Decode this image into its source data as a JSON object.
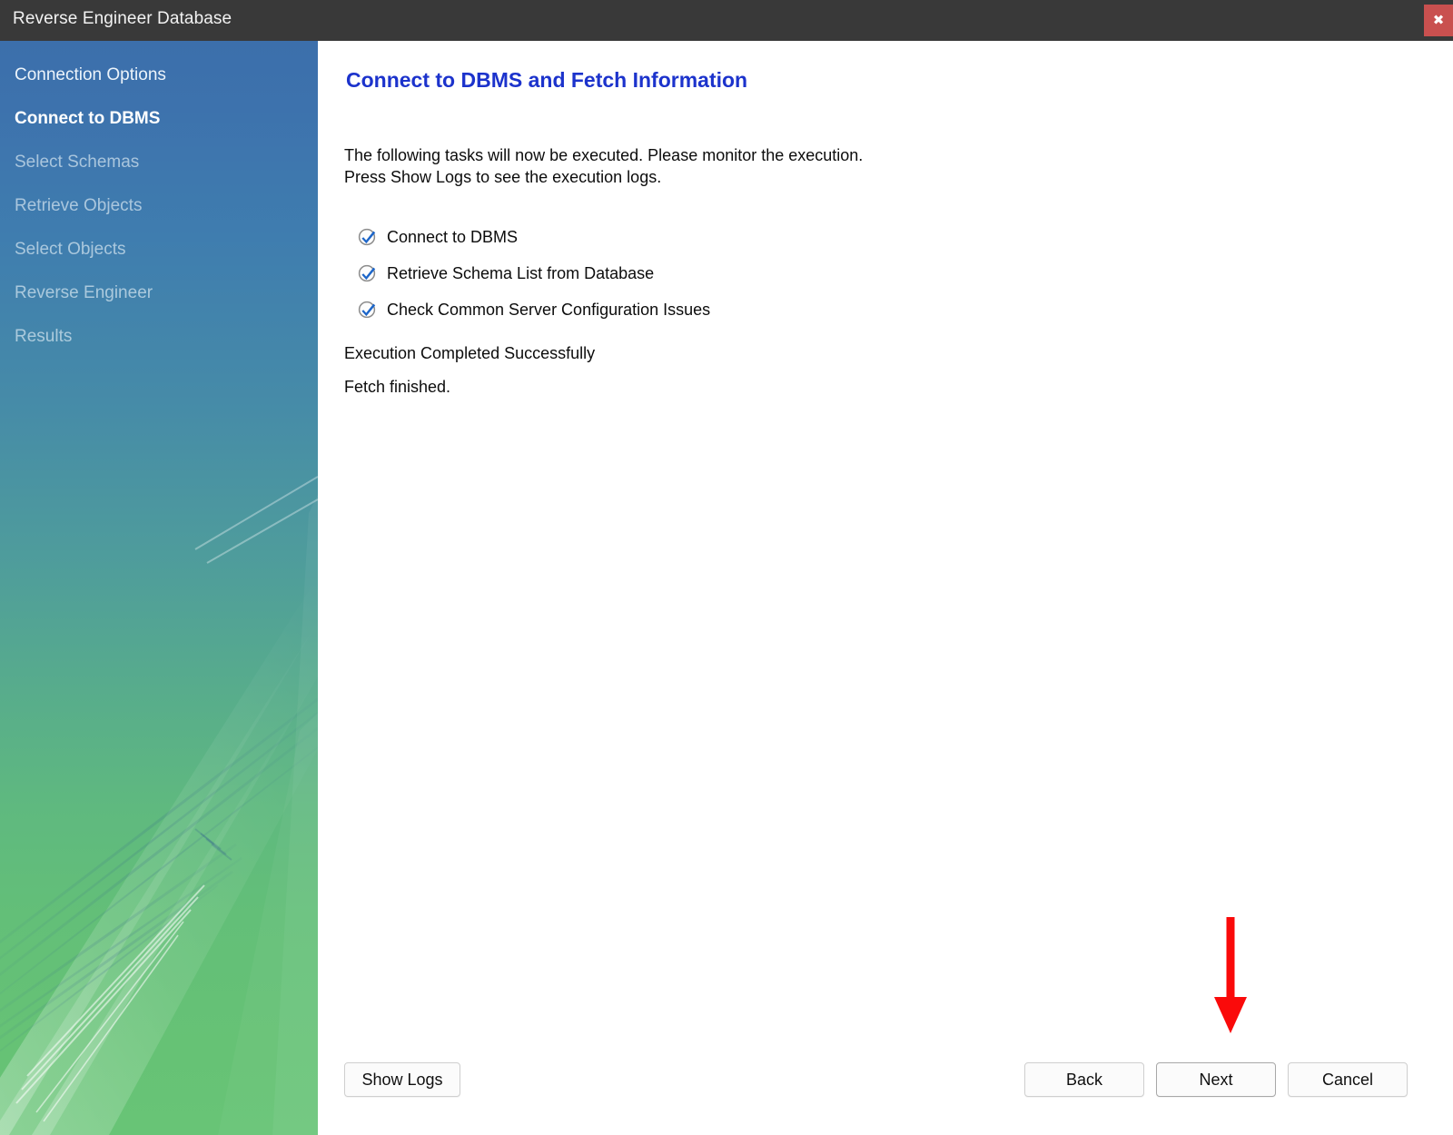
{
  "window": {
    "title": "Reverse Engineer Database",
    "close_label": "✖",
    "close_icon": "close-icon"
  },
  "sidebar": {
    "items": [
      {
        "label": "Connection Options",
        "state": "visited"
      },
      {
        "label": "Connect to DBMS",
        "state": "current"
      },
      {
        "label": "Select Schemas",
        "state": "upcoming"
      },
      {
        "label": "Retrieve Objects",
        "state": "upcoming"
      },
      {
        "label": "Select Objects",
        "state": "upcoming"
      },
      {
        "label": "Reverse Engineer",
        "state": "upcoming"
      },
      {
        "label": "Results",
        "state": "upcoming"
      }
    ]
  },
  "main": {
    "page_title": "Connect to DBMS and Fetch Information",
    "intro_line1": "The following tasks will now be executed. Please monitor the execution.",
    "intro_line2": "Press Show Logs to see the execution logs.",
    "tasks": [
      {
        "label": "Connect to DBMS",
        "checked": true,
        "icon": "check-circle-icon"
      },
      {
        "label": "Retrieve Schema List from Database",
        "checked": true,
        "icon": "check-circle-icon"
      },
      {
        "label": "Check Common Server Configuration Issues",
        "checked": true,
        "icon": "check-circle-icon"
      }
    ],
    "status_line1": "Execution Completed Successfully",
    "status_line2": "Fetch finished."
  },
  "annotation": {
    "icon": "down-arrow-icon",
    "color": "#fa0a0a",
    "points_to": "Next"
  },
  "footer": {
    "show_logs_label": "Show Logs",
    "back_label": "Back",
    "next_label": "Next",
    "cancel_label": "Cancel"
  },
  "colors": {
    "titlebar_bg": "#393939",
    "close_bg": "#c9504f",
    "sidebar_top": "#3c6fab",
    "sidebar_bottom": "#68c476",
    "heading": "#1c33cc",
    "check_blue": "#1d66c9",
    "annotation_red": "#fa0a0a"
  }
}
